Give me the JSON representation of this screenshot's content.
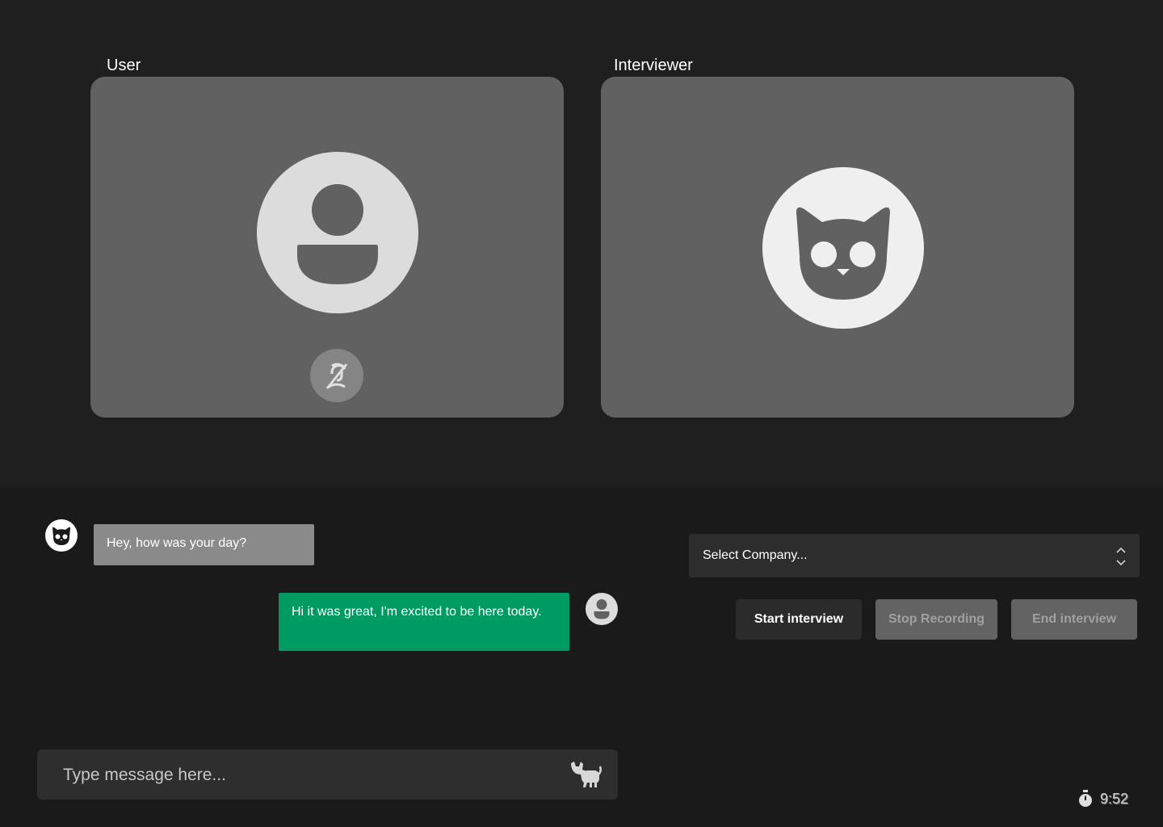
{
  "video": {
    "user_label": "User",
    "interviewer_label": "Interviewer"
  },
  "chat": {
    "messages": [
      {
        "sender": "interviewer",
        "text": "Hey, how was your day?"
      },
      {
        "sender": "user",
        "text": "Hi it was great, I'm excited to be here today."
      }
    ],
    "input_placeholder": "Type message here..."
  },
  "controls": {
    "select_company": "Select Company...",
    "start_label": "Start interview",
    "stop_label": "Stop Recording",
    "end_label": "End interview"
  },
  "timer": {
    "value": "9:52"
  },
  "icons": {
    "user_avatar": "user-icon",
    "interviewer_avatar": "cat-face-icon",
    "mic": "microphone-off-icon",
    "send": "cat-icon",
    "select": "chevron-up-down-icon",
    "timer": "stopwatch-icon"
  },
  "colors": {
    "user_bubble": "#009b63",
    "interviewer_bubble": "#8a8a8a",
    "tile": "#626162"
  }
}
